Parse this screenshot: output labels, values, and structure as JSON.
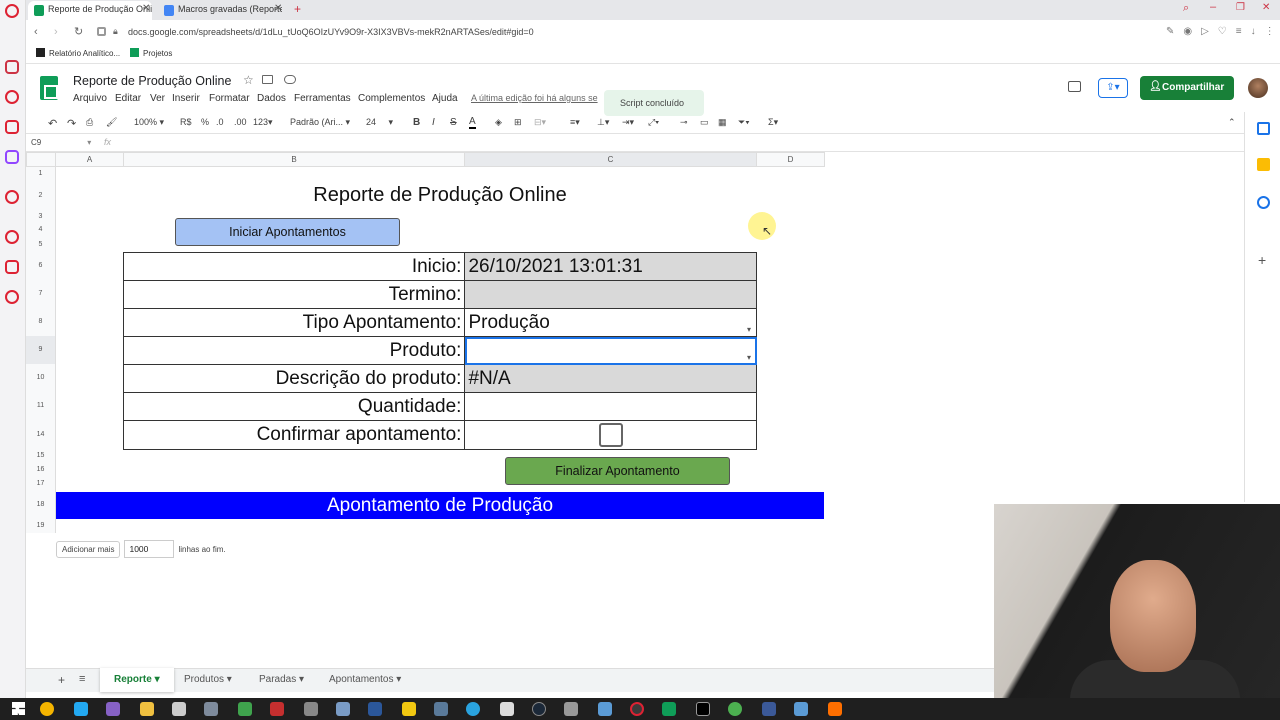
{
  "browser": {
    "tabs": [
      {
        "label": "Reporte de Produção Onlin",
        "active": true
      },
      {
        "label": "Macros gravadas (Reporte",
        "active": false
      }
    ],
    "new_tab": "+",
    "url": "docs.google.com/spreadsheets/d/1dLu_tUoQ6OIzUYv9O9r-X3IX3VBVs-mekR2nARTASes/edit#gid=0",
    "bookmarks": [
      "Relatório Analítico...",
      "Projetos"
    ]
  },
  "sheets": {
    "doc_title": "Reporte de Produção Online",
    "menus": [
      "Arquivo",
      "Editar",
      "Ver",
      "Inserir",
      "Formatar",
      "Dados",
      "Ferramentas",
      "Complementos",
      "Ajuda"
    ],
    "last_edit": "A última edição foi há alguns se",
    "toast": "Script concluído",
    "share_label": "Compartilhar",
    "toolbar": {
      "zoom": "100%",
      "currency": "R$",
      "percent": "%",
      "dec_less": ".0",
      "dec_more": ".00",
      "number_format": "123",
      "font": "Padrão (Ari...",
      "font_size": "24"
    },
    "namebox": "C9",
    "fx": "fx",
    "columns": [
      "A",
      "B",
      "C",
      "D"
    ],
    "rows": [
      "1",
      "2",
      "3",
      "4",
      "5",
      "6",
      "7",
      "8",
      "9",
      "10",
      "11",
      "14",
      "15",
      "16",
      "17",
      "18",
      "19"
    ]
  },
  "form": {
    "title": "Reporte de Produção Online",
    "start_button": "Iniciar Apontamentos",
    "end_button": "Finalizar Apontamento",
    "fields": [
      {
        "label": "Inicio:",
        "value": "26/10/2021 13:01:31"
      },
      {
        "label": "Termino:",
        "value": ""
      },
      {
        "label": "Tipo Apontamento:",
        "value": "Produção"
      },
      {
        "label": "Produto:",
        "value": ""
      },
      {
        "label": "Descrição do produto:",
        "value": "#N/A"
      },
      {
        "label": "Quantidade:",
        "value": ""
      },
      {
        "label": "Confirmar apontamento:",
        "value": ""
      }
    ],
    "confirm_checked": false,
    "banner": "Apontamento de Produção"
  },
  "add_rows": {
    "button": "Adicionar mais",
    "value": "1000",
    "suffix": "linhas ao fim."
  },
  "sheet_tabs": [
    {
      "label": "Reporte",
      "active": true
    },
    {
      "label": "Produtos",
      "active": false
    },
    {
      "label": "Paradas",
      "active": false
    },
    {
      "label": "Apontamentos",
      "active": false
    }
  ],
  "colors": {
    "sheets_green": "#188038",
    "start_button": "#a4c2f4",
    "end_button": "#6aa84f",
    "banner": "#0000ff",
    "gray_cell": "#d9d9d9"
  }
}
